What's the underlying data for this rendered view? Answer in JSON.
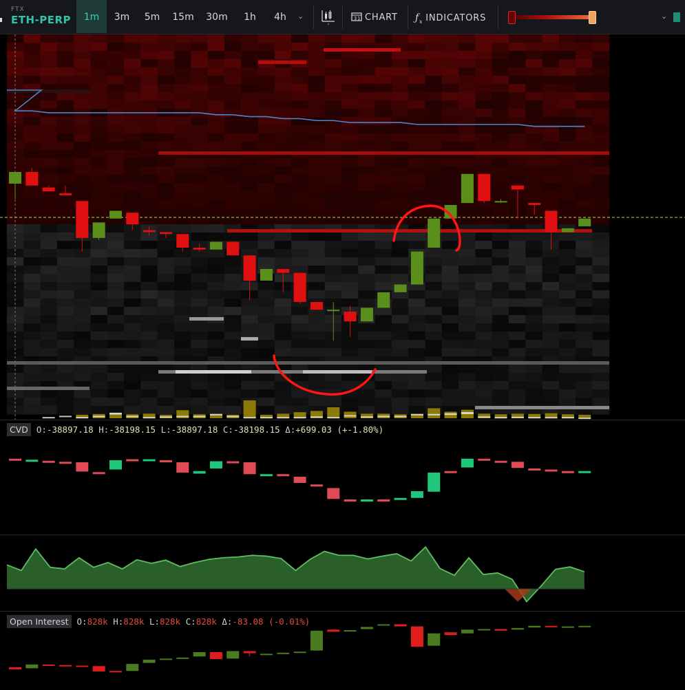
{
  "toolbar": {
    "exchange": "FTX",
    "symbol": "ETH-PERP",
    "timeframes": [
      "1m",
      "3m",
      "5m",
      "15m",
      "30m",
      "1h",
      "4h"
    ],
    "active_timeframe": "1m",
    "chart_label": "CHART",
    "indicators_label": "INDICATORS"
  },
  "colors": {
    "accent": "#2fc3a8",
    "bull": "#5a8f1c",
    "bear": "#e01010",
    "cvd_up": "#1fc77a",
    "cvd_down": "#e04a55",
    "oi_up": "#4a7c1f",
    "oi_down": "#e01d1d",
    "vwap": "#4a86c8"
  },
  "cvd": {
    "tag": "CVD",
    "o_label": "O:",
    "o": "-38897.18",
    "h_label": "H:",
    "h": "-38198.15",
    "l_label": "L:",
    "l": "-38897.18",
    "c_label": "C:",
    "c": "-38198.15",
    "delta_label": "Δ:",
    "delta": "+699.03 (+-1.80%)"
  },
  "open_interest": {
    "tag": "Open Interest",
    "o_label": "O:",
    "o": "828k",
    "h_label": "H:",
    "h": "828k",
    "l_label": "L:",
    "l": "828k",
    "c_label": "C:",
    "c": "828k",
    "delta_label": "Δ:",
    "delta": "-83.08 (-0.01%)"
  },
  "chart_data": [
    {
      "type": "candlestick",
      "name": "price",
      "candles": [
        {
          "o": 0.94,
          "h": 1.0,
          "l": 0.86,
          "c": 1.0
        },
        {
          "o": 1.0,
          "h": 1.02,
          "l": 0.93,
          "c": 0.93
        },
        {
          "o": 0.92,
          "h": 0.93,
          "l": 0.9,
          "c": 0.9
        },
        {
          "o": 0.89,
          "h": 0.93,
          "l": 0.88,
          "c": 0.88
        },
        {
          "o": 0.85,
          "h": 0.85,
          "l": 0.59,
          "c": 0.66
        },
        {
          "o": 0.66,
          "h": 0.74,
          "l": 0.65,
          "c": 0.74
        },
        {
          "o": 0.76,
          "h": 0.8,
          "l": 0.76,
          "c": 0.8
        },
        {
          "o": 0.79,
          "h": 0.79,
          "l": 0.7,
          "c": 0.73
        },
        {
          "o": 0.7,
          "h": 0.72,
          "l": 0.67,
          "c": 0.69
        },
        {
          "o": 0.69,
          "h": 0.69,
          "l": 0.66,
          "c": 0.68
        },
        {
          "o": 0.68,
          "h": 0.68,
          "l": 0.59,
          "c": 0.61
        },
        {
          "o": 0.61,
          "h": 0.63,
          "l": 0.59,
          "c": 0.6
        },
        {
          "o": 0.6,
          "h": 0.64,
          "l": 0.6,
          "c": 0.64
        },
        {
          "o": 0.64,
          "h": 0.64,
          "l": 0.57,
          "c": 0.57
        },
        {
          "o": 0.57,
          "h": 0.57,
          "l": 0.34,
          "c": 0.44
        },
        {
          "o": 0.44,
          "h": 0.5,
          "l": 0.44,
          "c": 0.5
        },
        {
          "o": 0.5,
          "h": 0.5,
          "l": 0.38,
          "c": 0.48
        },
        {
          "o": 0.48,
          "h": 0.48,
          "l": 0.32,
          "c": 0.33
        },
        {
          "o": 0.33,
          "h": 0.33,
          "l": 0.29,
          "c": 0.29
        },
        {
          "o": 0.29,
          "h": 0.33,
          "l": 0.13,
          "c": 0.29
        },
        {
          "o": 0.28,
          "h": 0.31,
          "l": 0.15,
          "c": 0.23
        },
        {
          "o": 0.23,
          "h": 0.3,
          "l": 0.23,
          "c": 0.3
        },
        {
          "o": 0.3,
          "h": 0.38,
          "l": 0.3,
          "c": 0.38
        },
        {
          "o": 0.38,
          "h": 0.42,
          "l": 0.38,
          "c": 0.42
        },
        {
          "o": 0.42,
          "h": 0.59,
          "l": 0.42,
          "c": 0.59
        },
        {
          "o": 0.61,
          "h": 0.76,
          "l": 0.61,
          "c": 0.76
        },
        {
          "o": 0.76,
          "h": 0.83,
          "l": 0.76,
          "c": 0.83
        },
        {
          "o": 0.84,
          "h": 0.99,
          "l": 0.84,
          "c": 0.99
        },
        {
          "o": 0.99,
          "h": 0.99,
          "l": 0.84,
          "c": 0.85
        },
        {
          "o": 0.85,
          "h": 0.86,
          "l": 0.84,
          "c": 0.85
        },
        {
          "o": 0.93,
          "h": 0.93,
          "l": 0.76,
          "c": 0.91
        },
        {
          "o": 0.84,
          "h": 0.84,
          "l": 0.78,
          "c": 0.83
        },
        {
          "o": 0.8,
          "h": 0.8,
          "l": 0.6,
          "c": 0.69
        },
        {
          "o": 0.69,
          "h": 0.71,
          "l": 0.69,
          "c": 0.71
        },
        {
          "o": 0.72,
          "h": 0.76,
          "l": 0.72,
          "c": 0.76
        }
      ],
      "vwap": [
        0.73,
        0.73,
        0.72,
        0.72,
        0.72,
        0.72,
        0.72,
        0.72,
        0.72,
        0.72,
        0.72,
        0.72,
        0.71,
        0.71,
        0.7,
        0.7,
        0.69,
        0.69,
        0.68,
        0.68,
        0.67,
        0.67,
        0.67,
        0.67,
        0.66,
        0.66,
        0.66,
        0.66,
        0.66,
        0.66,
        0.66,
        0.65,
        0.65,
        0.65,
        0.65
      ],
      "current_level": 0.72,
      "volume": [
        0,
        0,
        0,
        0,
        0.05,
        0.1,
        0.18,
        0.08,
        0.12,
        0.05,
        0.35,
        0.08,
        0.1,
        0.05,
        1.0,
        0.05,
        0.12,
        0.22,
        0.3,
        0.55,
        0.25,
        0.12,
        0.12,
        0.08,
        0.1,
        0.48,
        0.25,
        0.38,
        0.12,
        0.08,
        0.12,
        0.1,
        0.15,
        0.08,
        0.05
      ],
      "volume_sell": [
        0,
        0,
        0.1,
        0.2,
        0.1,
        0.2,
        0.45,
        0.2,
        0.1,
        0.15,
        0.2,
        0.2,
        0.35,
        0.2,
        0.1,
        0.1,
        0.1,
        0.1,
        0.15,
        0.1,
        0.25,
        0.15,
        0.2,
        0.2,
        0.35,
        0.35,
        0.4,
        0.5,
        0.15,
        0.1,
        0.12,
        0.1,
        0.1,
        0.1,
        0.05
      ]
    },
    {
      "type": "candlestick",
      "name": "CVD",
      "candles": [
        {
          "o": 0.83,
          "h": 0.83,
          "l": 0.8,
          "c": 0.8
        },
        {
          "o": 0.8,
          "h": 0.8,
          "l": 0.8,
          "c": 0.81
        },
        {
          "o": 0.79,
          "h": 0.79,
          "l": 0.78,
          "c": 0.78
        },
        {
          "o": 0.77,
          "h": 0.77,
          "l": 0.76,
          "c": 0.76
        },
        {
          "o": 0.76,
          "h": 0.76,
          "l": 0.58,
          "c": 0.58
        },
        {
          "o": 0.57,
          "h": 0.57,
          "l": 0.54,
          "c": 0.54
        },
        {
          "o": 0.62,
          "h": 0.8,
          "l": 0.62,
          "c": 0.8
        },
        {
          "o": 0.82,
          "h": 0.82,
          "l": 0.8,
          "c": 0.8
        },
        {
          "o": 0.81,
          "h": 0.82,
          "l": 0.81,
          "c": 0.82
        },
        {
          "o": 0.8,
          "h": 0.8,
          "l": 0.78,
          "c": 0.78
        },
        {
          "o": 0.76,
          "h": 0.76,
          "l": 0.56,
          "c": 0.56
        },
        {
          "o": 0.54,
          "h": 0.59,
          "l": 0.54,
          "c": 0.59
        },
        {
          "o": 0.64,
          "h": 0.78,
          "l": 0.64,
          "c": 0.78
        },
        {
          "o": 0.78,
          "h": 0.78,
          "l": 0.76,
          "c": 0.76
        },
        {
          "o": 0.76,
          "h": 0.76,
          "l": 0.53,
          "c": 0.53
        },
        {
          "o": 0.52,
          "h": 0.53,
          "l": 0.52,
          "c": 0.53
        },
        {
          "o": 0.53,
          "h": 0.53,
          "l": 0.51,
          "c": 0.51
        },
        {
          "o": 0.48,
          "h": 0.48,
          "l": 0.36,
          "c": 0.36
        },
        {
          "o": 0.33,
          "h": 0.33,
          "l": 0.31,
          "c": 0.31
        },
        {
          "o": 0.26,
          "h": 0.26,
          "l": 0.05,
          "c": 0.05
        },
        {
          "o": 0.04,
          "h": 0.04,
          "l": 0.0,
          "c": 0.0
        },
        {
          "o": 0.0,
          "h": 0.04,
          "l": 0.0,
          "c": 0.04
        },
        {
          "o": 0.04,
          "h": 0.04,
          "l": 0.02,
          "c": 0.02
        },
        {
          "o": 0.05,
          "h": 0.07,
          "l": 0.05,
          "c": 0.07
        },
        {
          "o": 0.07,
          "h": 0.2,
          "l": 0.07,
          "c": 0.2
        },
        {
          "o": 0.19,
          "h": 0.56,
          "l": 0.19,
          "c": 0.56
        },
        {
          "o": 0.59,
          "h": 0.59,
          "l": 0.56,
          "c": 0.56
        },
        {
          "o": 0.66,
          "h": 0.83,
          "l": 0.66,
          "c": 0.83
        },
        {
          "o": 0.83,
          "h": 0.83,
          "l": 0.8,
          "c": 0.8
        },
        {
          "o": 0.79,
          "h": 0.79,
          "l": 0.77,
          "c": 0.77
        },
        {
          "o": 0.77,
          "h": 0.77,
          "l": 0.65,
          "c": 0.65
        },
        {
          "o": 0.64,
          "h": 0.64,
          "l": 0.62,
          "c": 0.62
        },
        {
          "o": 0.62,
          "h": 0.62,
          "l": 0.58,
          "c": 0.58
        },
        {
          "o": 0.59,
          "h": 0.59,
          "l": 0.57,
          "c": 0.57
        },
        {
          "o": 0.58,
          "h": 0.59,
          "l": 0.58,
          "c": 0.59
        }
      ]
    },
    {
      "type": "area",
      "name": "oscillator",
      "values": [
        0.6,
        0.46,
        1.0,
        0.54,
        0.5,
        0.78,
        0.54,
        0.66,
        0.5,
        0.73,
        0.64,
        0.72,
        0.56,
        0.66,
        0.74,
        0.78,
        0.8,
        0.84,
        0.82,
        0.76,
        0.46,
        0.74,
        0.94,
        0.84,
        0.84,
        0.75,
        0.82,
        0.88,
        0.7,
        1.05,
        0.51,
        0.34,
        0.78,
        0.36,
        0.4,
        0.24,
        -0.32,
        0.07,
        0.49,
        0.55,
        0.43
      ],
      "baseline": 0
    },
    {
      "type": "candlestick",
      "name": "Open Interest",
      "candles": [
        {
          "o": 0.22,
          "h": 0.22,
          "l": 0.18,
          "c": 0.18
        },
        {
          "o": 0.2,
          "h": 0.27,
          "l": 0.2,
          "c": 0.27
        },
        {
          "o": 0.27,
          "h": 0.27,
          "l": 0.26,
          "c": 0.26
        },
        {
          "o": 0.26,
          "h": 0.26,
          "l": 0.25,
          "c": 0.25
        },
        {
          "o": 0.25,
          "h": 0.25,
          "l": 0.24,
          "c": 0.24
        },
        {
          "o": 0.24,
          "h": 0.24,
          "l": 0.14,
          "c": 0.14
        },
        {
          "o": 0.15,
          "h": 0.15,
          "l": 0.14,
          "c": 0.14
        },
        {
          "o": 0.15,
          "h": 0.28,
          "l": 0.15,
          "c": 0.28
        },
        {
          "o": 0.3,
          "h": 0.36,
          "l": 0.3,
          "c": 0.36
        },
        {
          "o": 0.36,
          "h": 0.38,
          "l": 0.36,
          "c": 0.38
        },
        {
          "o": 0.38,
          "h": 0.4,
          "l": 0.38,
          "c": 0.4
        },
        {
          "o": 0.42,
          "h": 0.5,
          "l": 0.42,
          "c": 0.5
        },
        {
          "o": 0.5,
          "h": 0.5,
          "l": 0.37,
          "c": 0.37
        },
        {
          "o": 0.38,
          "h": 0.52,
          "l": 0.38,
          "c": 0.52
        },
        {
          "o": 0.52,
          "h": 0.52,
          "l": 0.42,
          "c": 0.48
        },
        {
          "o": 0.45,
          "h": 0.47,
          "l": 0.45,
          "c": 0.47
        },
        {
          "o": 0.47,
          "h": 0.49,
          "l": 0.47,
          "c": 0.49
        },
        {
          "o": 0.49,
          "h": 0.51,
          "l": 0.49,
          "c": 0.51
        },
        {
          "o": 0.53,
          "h": 0.9,
          "l": 0.53,
          "c": 0.9
        },
        {
          "o": 0.92,
          "h": 0.92,
          "l": 0.88,
          "c": 0.88
        },
        {
          "o": 0.89,
          "h": 0.91,
          "l": 0.89,
          "c": 0.91
        },
        {
          "o": 0.93,
          "h": 0.97,
          "l": 0.93,
          "c": 0.97
        },
        {
          "o": 1.0,
          "h": 1.02,
          "l": 1.0,
          "c": 1.02
        },
        {
          "o": 1.02,
          "h": 1.02,
          "l": 0.98,
          "c": 0.98
        },
        {
          "o": 0.98,
          "h": 0.98,
          "l": 0.6,
          "c": 0.6
        },
        {
          "o": 0.62,
          "h": 0.85,
          "l": 0.62,
          "c": 0.85
        },
        {
          "o": 0.87,
          "h": 0.87,
          "l": 0.82,
          "c": 0.82
        },
        {
          "o": 0.85,
          "h": 0.92,
          "l": 0.85,
          "c": 0.92
        },
        {
          "o": 0.92,
          "h": 0.93,
          "l": 0.92,
          "c": 0.93
        },
        {
          "o": 0.93,
          "h": 0.93,
          "l": 0.9,
          "c": 0.9
        },
        {
          "o": 0.92,
          "h": 0.95,
          "l": 0.92,
          "c": 0.95
        },
        {
          "o": 0.96,
          "h": 0.99,
          "l": 0.96,
          "c": 0.99
        },
        {
          "o": 0.99,
          "h": 0.99,
          "l": 0.97,
          "c": 0.97
        },
        {
          "o": 0.97,
          "h": 0.98,
          "l": 0.97,
          "c": 0.98
        },
        {
          "o": 0.98,
          "h": 0.99,
          "l": 0.98,
          "c": 0.99
        }
      ]
    }
  ]
}
